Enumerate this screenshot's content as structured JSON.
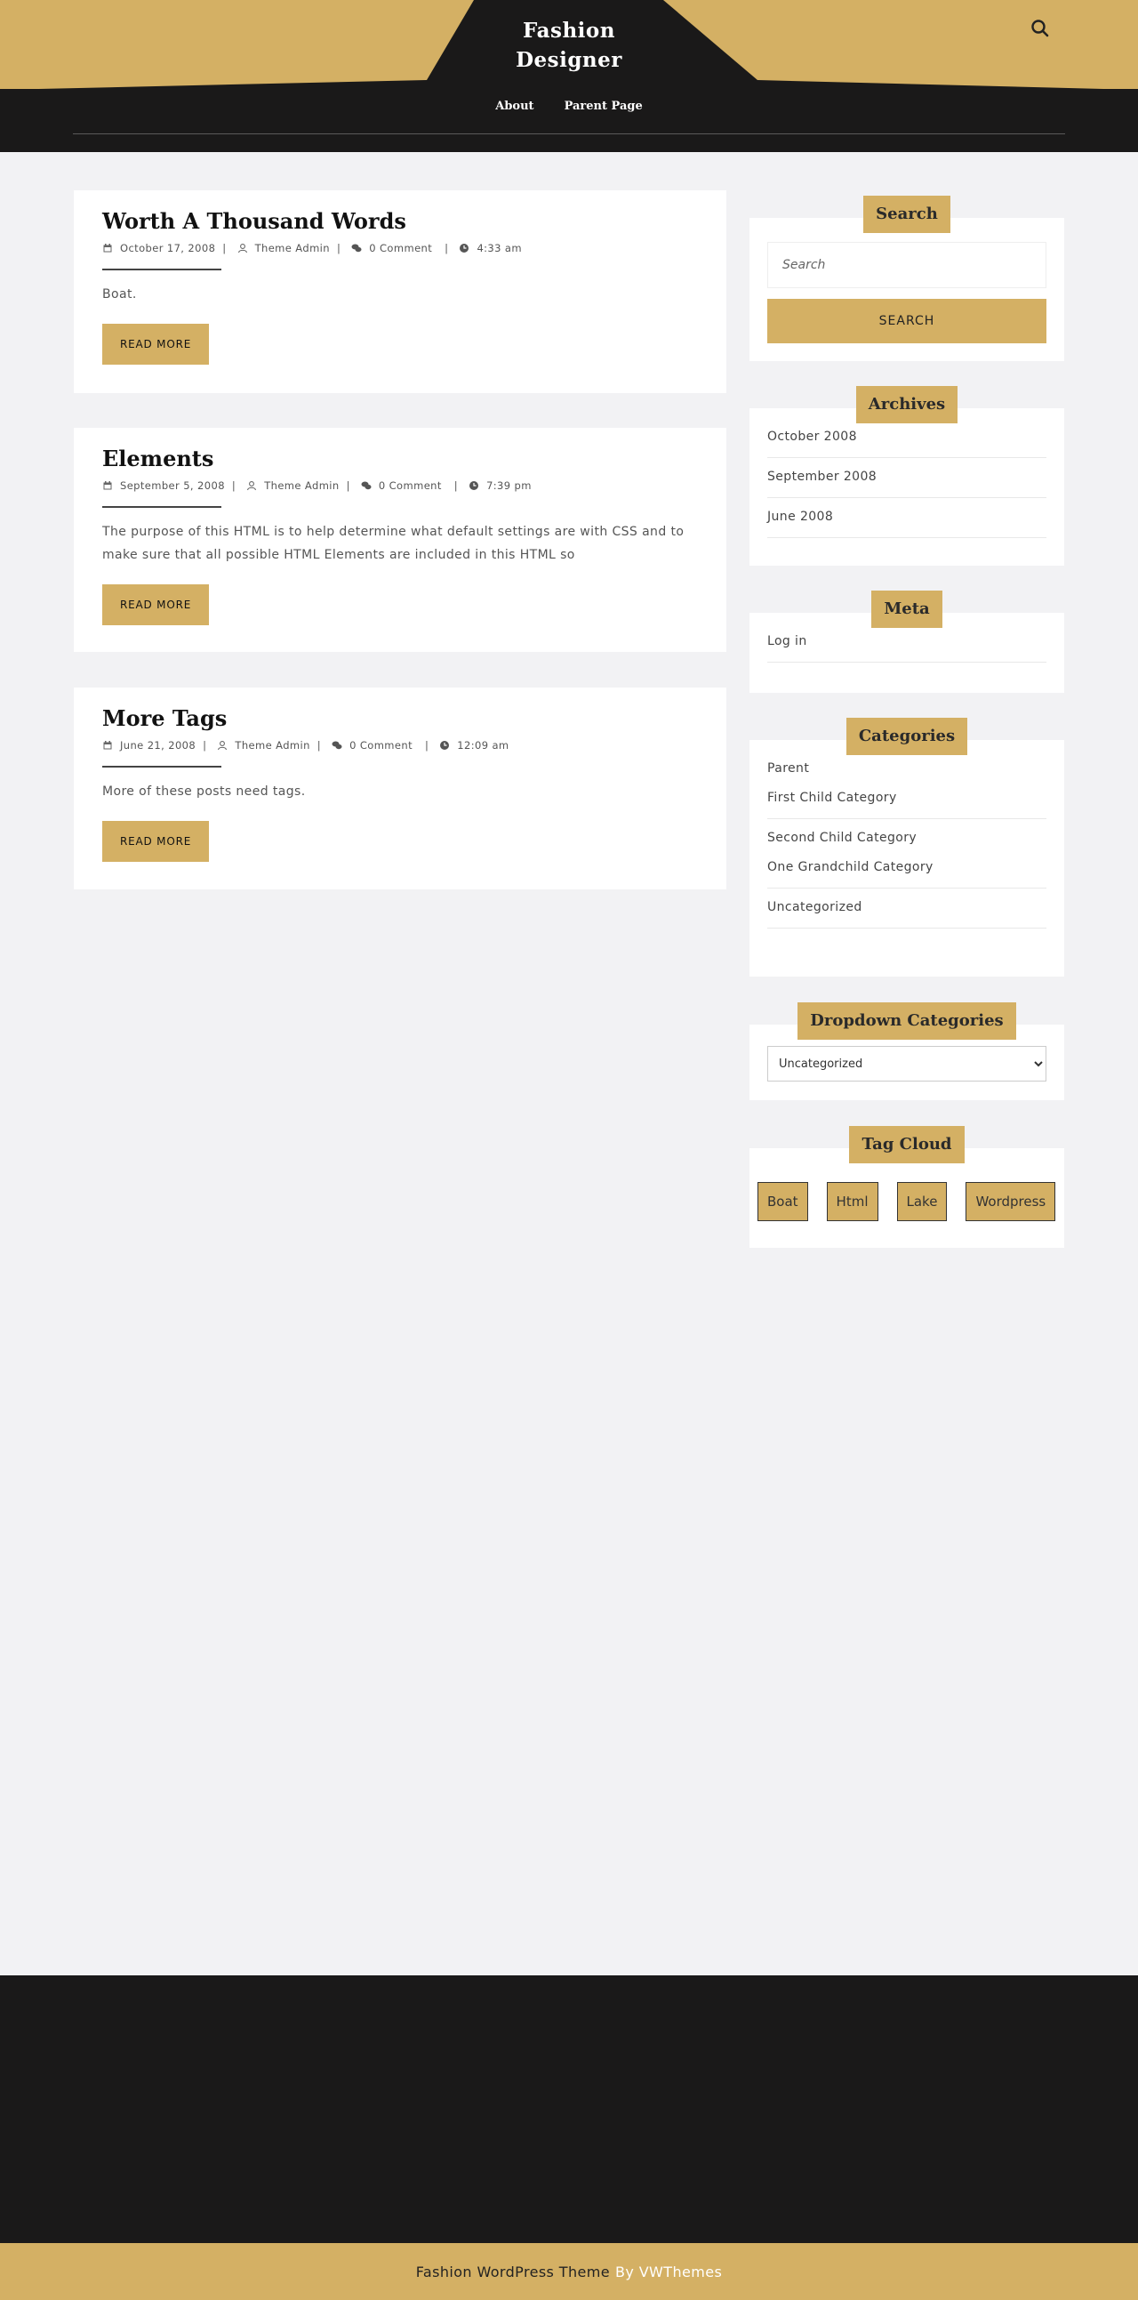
{
  "site": {
    "title_line1": "Fashion",
    "title_line2": "Designer"
  },
  "nav": {
    "about": "About",
    "parent_page": "Parent Page"
  },
  "posts": [
    {
      "title": "Worth A Thousand Words",
      "date": "October 17, 2008",
      "author": "Theme Admin",
      "comments": "0 Comment",
      "time": "4:33 am",
      "excerpt": "Boat.",
      "read_more": "READ MORE"
    },
    {
      "title": "Elements",
      "date": "September 5, 2008",
      "author": "Theme Admin",
      "comments": "0 Comment",
      "time": "7:39 pm",
      "excerpt": "The purpose of this HTML is to help determine what default settings are with CSS and to make sure that all possible HTML Elements are included in this HTML so",
      "read_more": "READ MORE"
    },
    {
      "title": "More Tags",
      "date": "June 21, 2008",
      "author": "Theme Admin",
      "comments": "0 Comment",
      "time": "12:09 am",
      "excerpt": "More of these posts need tags.",
      "read_more": "READ MORE"
    }
  ],
  "sidebar": {
    "search": {
      "title": "Search",
      "placeholder": "Search",
      "button": "SEARCH"
    },
    "archives": {
      "title": "Archives",
      "items": [
        "October 2008",
        "September 2008",
        "June 2008"
      ]
    },
    "meta": {
      "title": "Meta",
      "items": [
        "Log in"
      ]
    },
    "categories": {
      "title": "Categories",
      "items": [
        "Parent",
        "First Child Category",
        "Second Child Category",
        "One Grandchild Category",
        "Uncategorized"
      ]
    },
    "dropdown": {
      "title": "Dropdown Categories",
      "selected": "Uncategorized"
    },
    "tag_cloud": {
      "title": "Tag Cloud",
      "tags": [
        "Boat",
        "Html",
        "Lake",
        "Wordpress"
      ]
    }
  },
  "footer": {
    "copyright": "Fashion WordPress Theme",
    "credit": "By VWThemes"
  },
  "colors": {
    "accent_gold": "#d4b064",
    "dark": "#1a1919",
    "background": "#f2f2f4"
  }
}
